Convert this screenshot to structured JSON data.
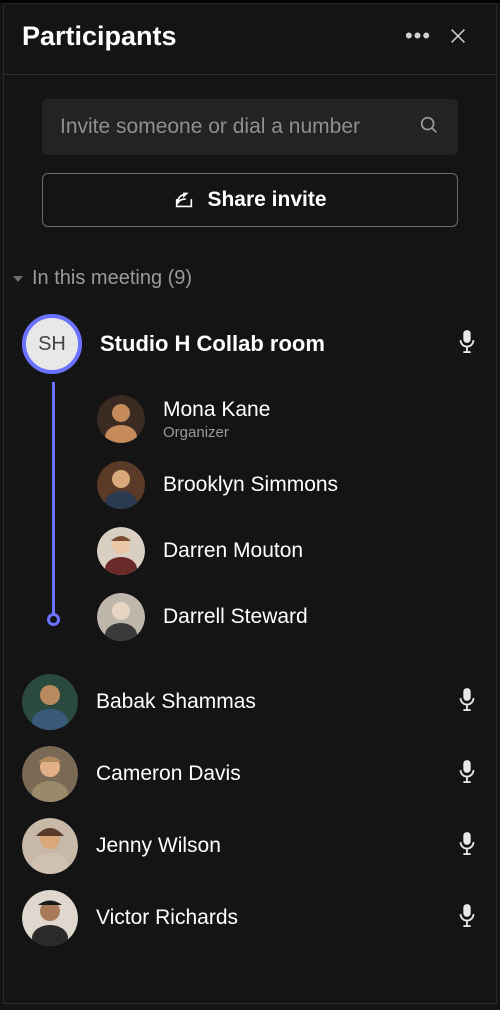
{
  "header": {
    "title": "Participants"
  },
  "search": {
    "placeholder": "Invite someone or dial a number"
  },
  "share_button_label": "Share invite",
  "section": {
    "label": "In this meeting (9)"
  },
  "room": {
    "avatar_initials": "SH",
    "name": "Studio H Collab room",
    "mic_on": true,
    "members": [
      {
        "name": "Mona Kane",
        "role": "Organizer",
        "avatar_colors": [
          "#c48a5a",
          "#3a2a22"
        ]
      },
      {
        "name": "Brooklyn Simmons",
        "role": "",
        "avatar_colors": [
          "#d9a97b",
          "#5b3a28"
        ]
      },
      {
        "name": "Darren Mouton",
        "role": "",
        "avatar_colors": [
          "#e9c7a6",
          "#7a4a31"
        ]
      },
      {
        "name": "Darrell Steward",
        "role": "",
        "avatar_colors": [
          "#e6d5c3",
          "#8a8070"
        ]
      }
    ]
  },
  "participants": [
    {
      "name": "Babak Shammas",
      "mic_on": true,
      "avatar_colors": [
        "#b98a5d",
        "#2a4a40"
      ]
    },
    {
      "name": "Cameron Davis",
      "mic_on": true,
      "avatar_colors": [
        "#e2b088",
        "#7a6a55"
      ]
    },
    {
      "name": "Jenny Wilson",
      "mic_on": true,
      "avatar_colors": [
        "#d8a87a",
        "#5c3a2a"
      ]
    },
    {
      "name": "Victor Richards",
      "mic_on": true,
      "avatar_colors": [
        "#a87a5a",
        "#2a2a2a"
      ]
    }
  ]
}
